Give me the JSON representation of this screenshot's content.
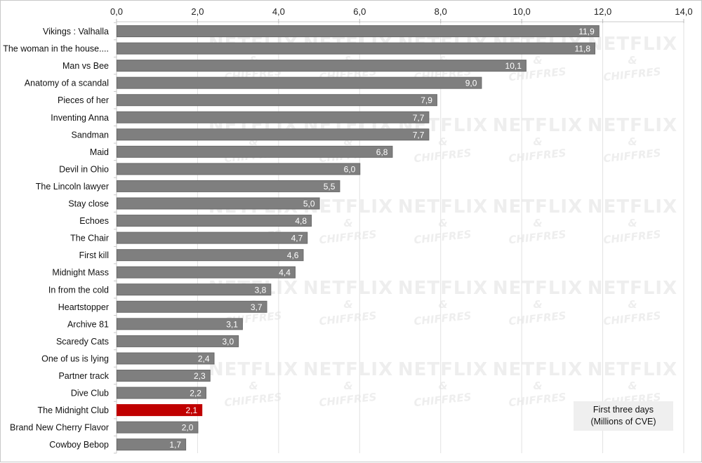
{
  "chart_data": {
    "type": "bar",
    "orientation": "horizontal",
    "title": "",
    "xlabel": "",
    "ylabel": "",
    "xlim": [
      0,
      14
    ],
    "x_ticks": [
      "0,0",
      "2,0",
      "4,0",
      "6,0",
      "8,0",
      "10,0",
      "12,0",
      "14,0"
    ],
    "x_tick_values": [
      0,
      2,
      4,
      6,
      8,
      10,
      12,
      14
    ],
    "x_axis_position": "top",
    "grid": true,
    "categories": [
      "Vikings : Valhalla",
      "The woman in the house....",
      "Man vs Bee",
      "Anatomy of a scandal",
      "Pieces of her",
      "Inventing Anna",
      "Sandman",
      "Maid",
      "Devil in Ohio",
      "The Lincoln lawyer",
      "Stay close",
      "Echoes",
      "The Chair",
      "First kill",
      "Midnight Mass",
      "In from the cold",
      "Heartstopper",
      "Archive 81",
      "Scaredy Cats",
      "One of us is lying",
      "Partner track",
      "Dive Club",
      "The Midnight Club",
      "Brand New Cherry Flavor",
      "Cowboy Bebop"
    ],
    "values": [
      11.9,
      11.8,
      10.1,
      9.0,
      7.9,
      7.7,
      7.7,
      6.8,
      6.0,
      5.5,
      5.0,
      4.8,
      4.7,
      4.6,
      4.4,
      3.8,
      3.7,
      3.1,
      3.0,
      2.4,
      2.3,
      2.2,
      2.1,
      2.0,
      1.7
    ],
    "value_labels": [
      "11,9",
      "11,8",
      "10,1",
      "9,0",
      "7,9",
      "7,7",
      "7,7",
      "6,8",
      "6,0",
      "5,5",
      "5,0",
      "4,8",
      "4,7",
      "4,6",
      "4,4",
      "3,8",
      "3,7",
      "3,1",
      "3,0",
      "2,4",
      "2,3",
      "2,2",
      "2,1",
      "2,0",
      "1,7"
    ],
    "highlight_category": "The Midnight Club",
    "colors": {
      "bar": "#7f7f7f",
      "bar_border": "#6a6a6a",
      "highlight": "#c00000",
      "grid": "#e2e2e2"
    },
    "legend": {
      "lines": [
        "First three days",
        "(Millions of CVE)"
      ],
      "position": "bottom-right"
    },
    "watermark": {
      "title": "NETFLIX",
      "amp": "&",
      "sub": "CHIFFRES"
    }
  }
}
